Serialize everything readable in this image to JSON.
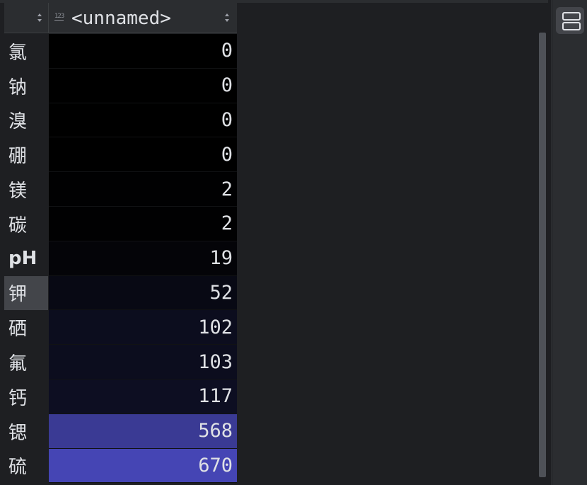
{
  "column": {
    "title": "<unnamed>",
    "type_icon": "123"
  },
  "rows": [
    {
      "label": "氯",
      "value": "0",
      "bg": "#000000"
    },
    {
      "label": "钠",
      "value": "0",
      "bg": "#000000"
    },
    {
      "label": "溴",
      "value": "0",
      "bg": "#000000"
    },
    {
      "label": "硼",
      "value": "0",
      "bg": "#000000"
    },
    {
      "label": "镁",
      "value": "2",
      "bg": "#010102"
    },
    {
      "label": "碳",
      "value": "2",
      "bg": "#010102"
    },
    {
      "label": "pH",
      "value": "19",
      "bg": "#040408"
    },
    {
      "label": "钾",
      "value": "52",
      "bg": "#080914"
    },
    {
      "label": "硒",
      "value": "102",
      "bg": "#0c0d1e"
    },
    {
      "label": "氟",
      "value": "103",
      "bg": "#0c0d1e"
    },
    {
      "label": "钙",
      "value": "117",
      "bg": "#0d0e22"
    },
    {
      "label": "锶",
      "value": "568",
      "bg": "#3a3a94"
    },
    {
      "label": "硫",
      "value": "670",
      "bg": "#4545b4"
    }
  ],
  "selected_row": "钾",
  "icons": {
    "corner_sort": "sort-arrows-icon",
    "column_sort": "sort-arrows-icon",
    "sidebar": "layout-rows-icon"
  }
}
